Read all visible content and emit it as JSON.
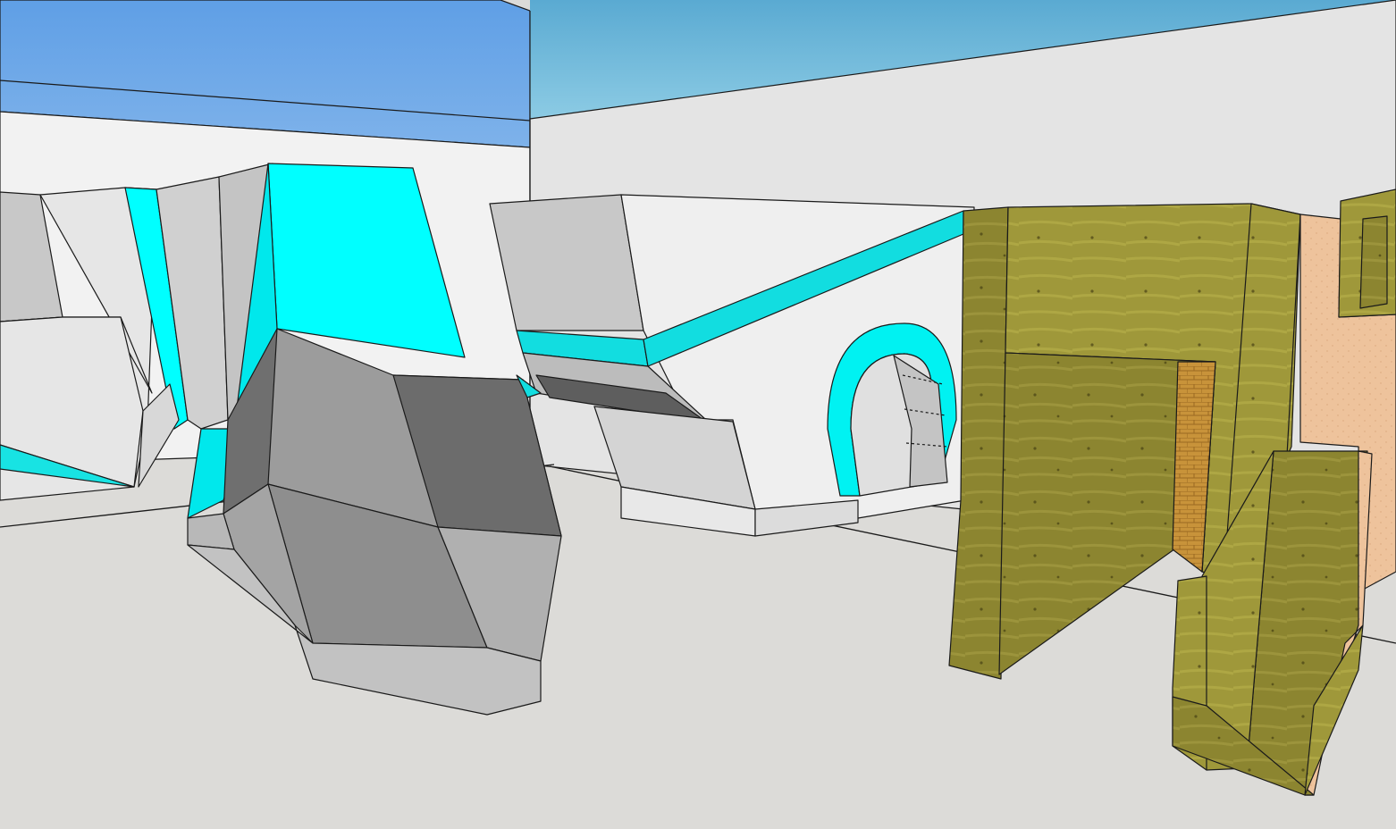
{
  "scene": {
    "description_visible_text": "",
    "colors": {
      "sky_blue": "#6aa6e4",
      "sky_cyan": "#6fb8d8",
      "wall_white": "#f2f2f2",
      "wall_light": "#e4e4e4",
      "ground": "#dcdbd8",
      "cyan_accent": "#00ffff",
      "cyan_dim": "#18d8dc",
      "rock_light": "#c0c0c0",
      "rock_mid": "#9a9a9a",
      "rock_dark": "#6c6c6c",
      "plywood": "#8c8530",
      "plywood_light": "#a29a3c",
      "brick": "#c8933a",
      "peach_panel": "#eec39c",
      "edge_line": "#1a1a1a"
    }
  }
}
